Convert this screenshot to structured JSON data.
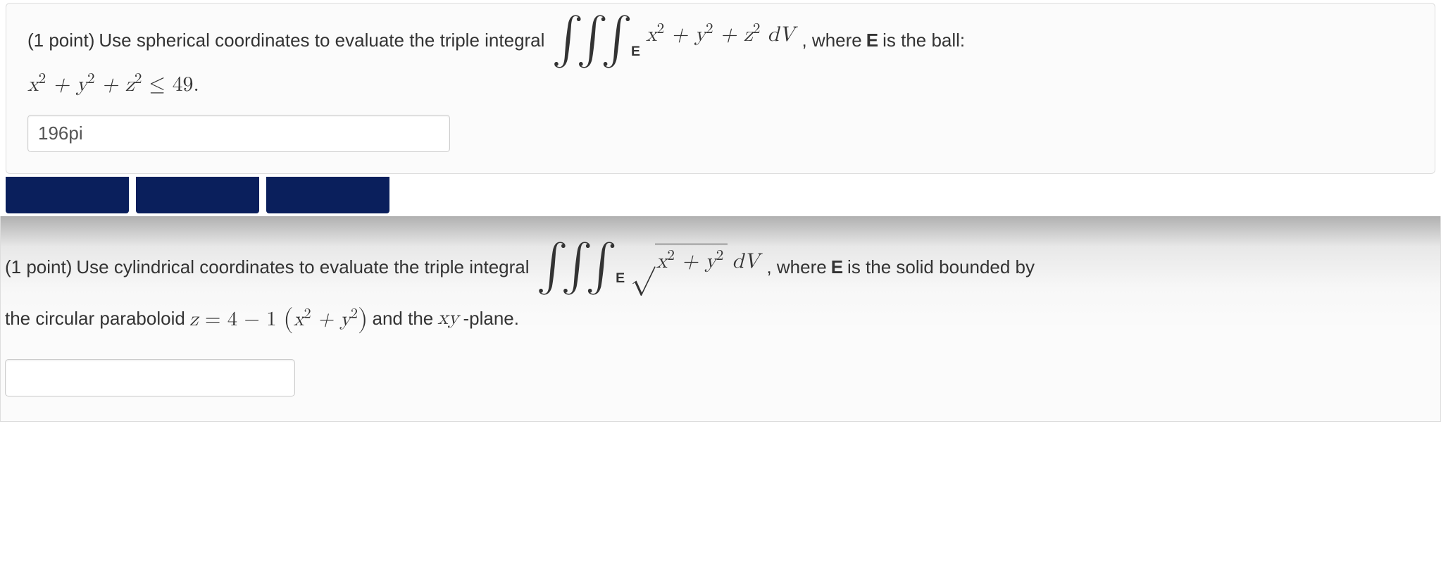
{
  "problem1": {
    "points_label": "(1 point)",
    "prompt_before": "Use spherical coordinates to evaluate the triple integral",
    "integrand_tex": "x² + y² + z² dV",
    "region_sub": "E",
    "prompt_after_1": ", where ",
    "region_bold": "E",
    "prompt_after_2": " is the ball:",
    "constraint_tex": "x² + y² + z² ≤ 49.",
    "answer_value": "196pi"
  },
  "problem2": {
    "points_label": "(1 point)",
    "prompt_before": "Use cylindrical coordinates to evaluate the triple integral",
    "radicand_tex": "x² + y²",
    "dV": "dV",
    "region_sub": "E",
    "prompt_after_1": ", where ",
    "region_bold": "E",
    "prompt_after_2": " is the solid bounded by",
    "line2_before": "the circular paraboloid ",
    "paraboloid_lhs": "z = 4 − 1 ",
    "paraboloid_inside": "x² + y²",
    "line2_after": " and the ",
    "xy": "xy",
    "plane_text": " -plane.",
    "answer_value": ""
  }
}
